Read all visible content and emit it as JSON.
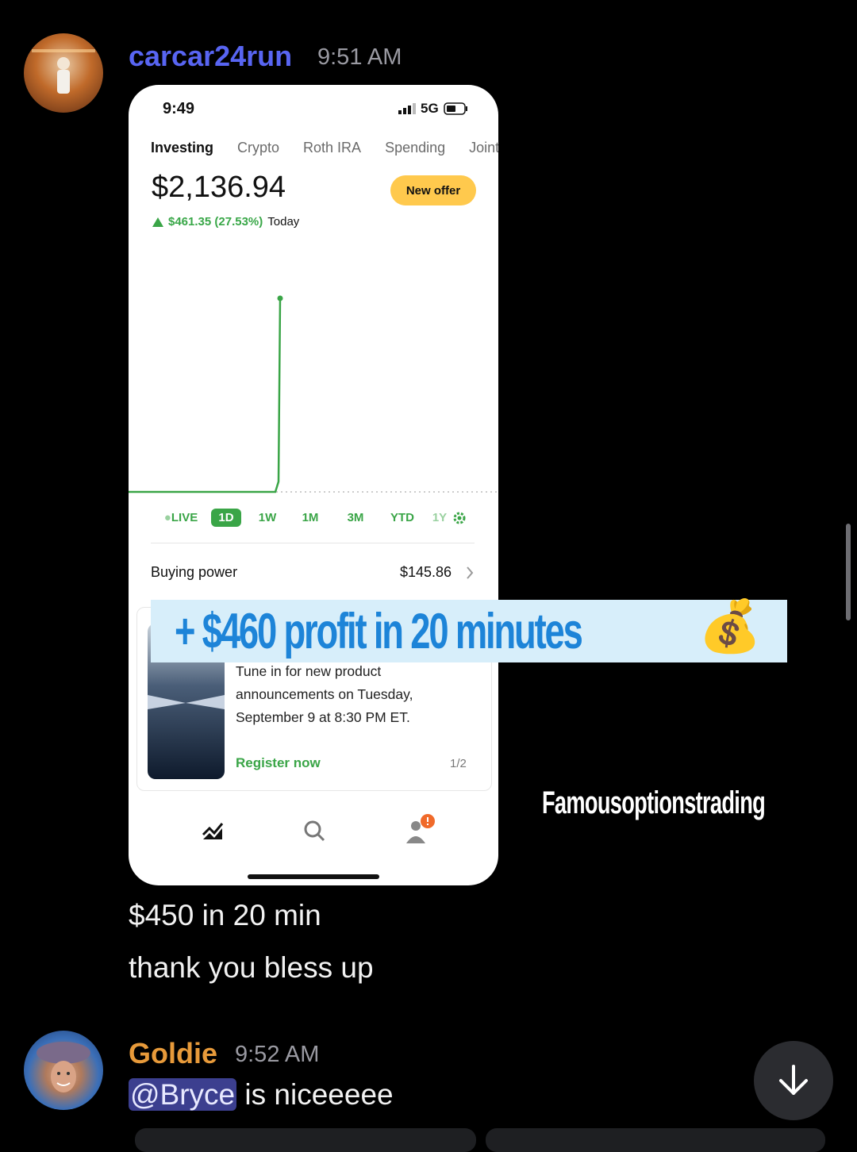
{
  "messages": [
    {
      "username": "carcar24run",
      "username_color": "#5865f2",
      "timestamp": "9:51 AM",
      "lines": [
        "$450 in 20 min",
        "thank you bless up"
      ]
    },
    {
      "username": "Goldie",
      "username_color": "#e79a3a",
      "timestamp": "9:52 AM",
      "mention": "@Bryce",
      "text": " is niceeeee"
    }
  ],
  "screenshot": {
    "status_time": "9:49",
    "network": "5G",
    "tabs": [
      "Investing",
      "Crypto",
      "Roth IRA",
      "Spending",
      "Joint"
    ],
    "active_tab": "Investing",
    "balance": "$2,136.94",
    "offer_button": "New offer",
    "change_value": "$461.35 (27.53%)",
    "change_period": "Today",
    "ranges": [
      "LIVE",
      "1D",
      "1W",
      "1M",
      "3M",
      "YTD",
      "1Y"
    ],
    "selected_range": "1D",
    "buying_power_label": "Buying power",
    "buying_power_value": "$145.86",
    "card_text": "Tune in for new product announcements on Tuesday, September 9 at 8:30 PM ET.",
    "card_link": "Register now",
    "card_page": "1/2",
    "accent_color": "#3aa547"
  },
  "overlay": {
    "banner": "+ $460 profit in 20 minutes",
    "banner_emoji": "💰",
    "watermark": "Famousoptionstrading"
  }
}
